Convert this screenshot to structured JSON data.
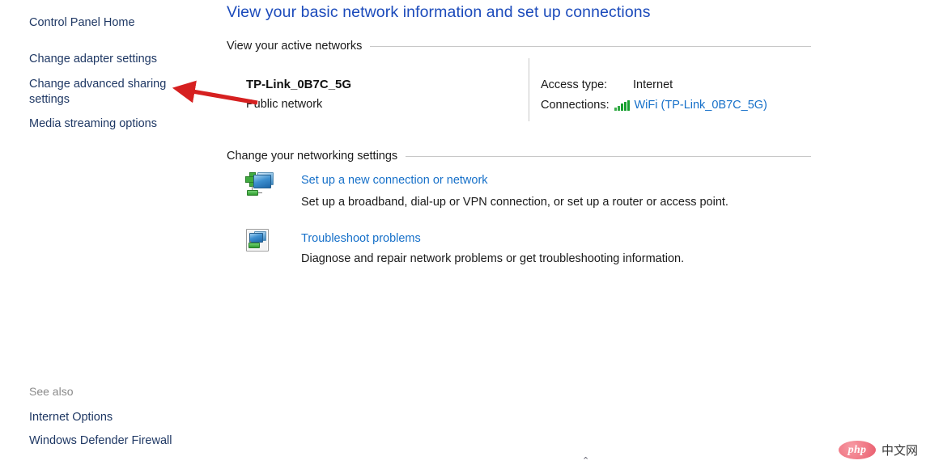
{
  "sidebar": {
    "links": [
      {
        "id": "control-panel-home",
        "label": "Control Panel Home"
      },
      {
        "id": "change-adapter-settings",
        "label": "Change adapter settings"
      },
      {
        "id": "change-advanced-sharing-settings",
        "label": "Change advanced sharing settings"
      },
      {
        "id": "media-streaming-options",
        "label": "Media streaming options"
      }
    ],
    "see_also": {
      "heading": "See also",
      "links": [
        {
          "id": "internet-options",
          "label": "Internet Options"
        },
        {
          "id": "windows-defender-firewall",
          "label": "Windows Defender Firewall"
        }
      ]
    }
  },
  "main": {
    "title": "View your basic network information and set up connections",
    "sections": {
      "active_networks": {
        "heading": "View your active networks",
        "network": {
          "name": "TP-Link_0B7C_5G",
          "type": "Public network"
        },
        "details": {
          "access_type_label": "Access type:",
          "access_type_value": "Internet",
          "connections_label": "Connections:",
          "connections_value": "WiFi (TP-Link_0B7C_5G)",
          "connections_icon": "wifi-signal-bars-icon"
        }
      },
      "change_settings": {
        "heading": "Change your networking settings",
        "tasks": [
          {
            "id": "setup-new-connection",
            "icon": "new-connection-icon",
            "link": "Set up a new connection or network",
            "description": "Set up a broadband, dial-up or VPN connection, or set up a router or access point."
          },
          {
            "id": "troubleshoot-problems",
            "icon": "troubleshoot-icon",
            "link": "Troubleshoot problems",
            "description": "Diagnose and repair network problems or get troubleshooting information."
          }
        ]
      }
    }
  },
  "annotation": {
    "arrow_color": "#d62020",
    "points_to": "change-advanced-sharing-settings"
  },
  "watermark": {
    "logo_text": "php",
    "label": "中文网"
  },
  "scroll_indicator": {
    "glyph": "⌃"
  },
  "colors": {
    "title_blue": "#1c4bbb",
    "link_blue": "#1670c9",
    "nav_blue": "#1f3864",
    "rule_gray": "#c8c8c8",
    "signal_green": "#17a02f"
  }
}
